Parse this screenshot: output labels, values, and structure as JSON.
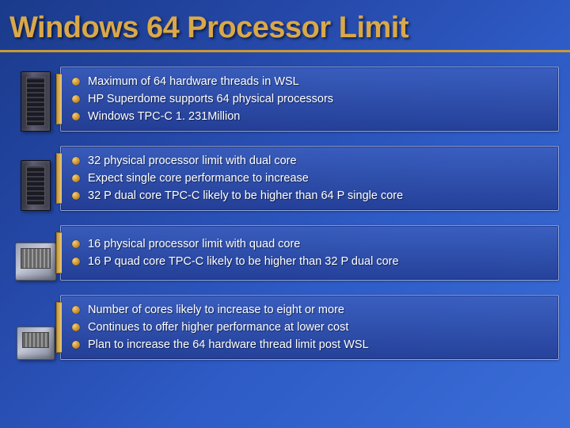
{
  "title": "Windows 64 Processor Limit",
  "rows": [
    {
      "icon": "server-rack-tall",
      "bullets": [
        "Maximum of 64 hardware threads in WSL",
        "HP Superdome supports 64 physical processors",
        "Windows TPC-C 1. 231Million"
      ]
    },
    {
      "icon": "server-rack-short",
      "bullets": [
        "32 physical processor limit with dual core",
        "Expect single core performance to increase",
        "32 P dual core TPC-C likely to be higher than 64 P single core"
      ]
    },
    {
      "icon": "server-cube",
      "bullets": [
        "16 physical processor limit with quad core",
        "16 P quad core TPC-C likely to be higher than 32 P dual core"
      ]
    },
    {
      "icon": "server-cube-small",
      "bullets": [
        "Number of cores likely to increase to eight or more",
        "Continues to offer higher performance at lower cost",
        "Plan to increase the 64 hardware thread limit post WSL"
      ]
    }
  ]
}
